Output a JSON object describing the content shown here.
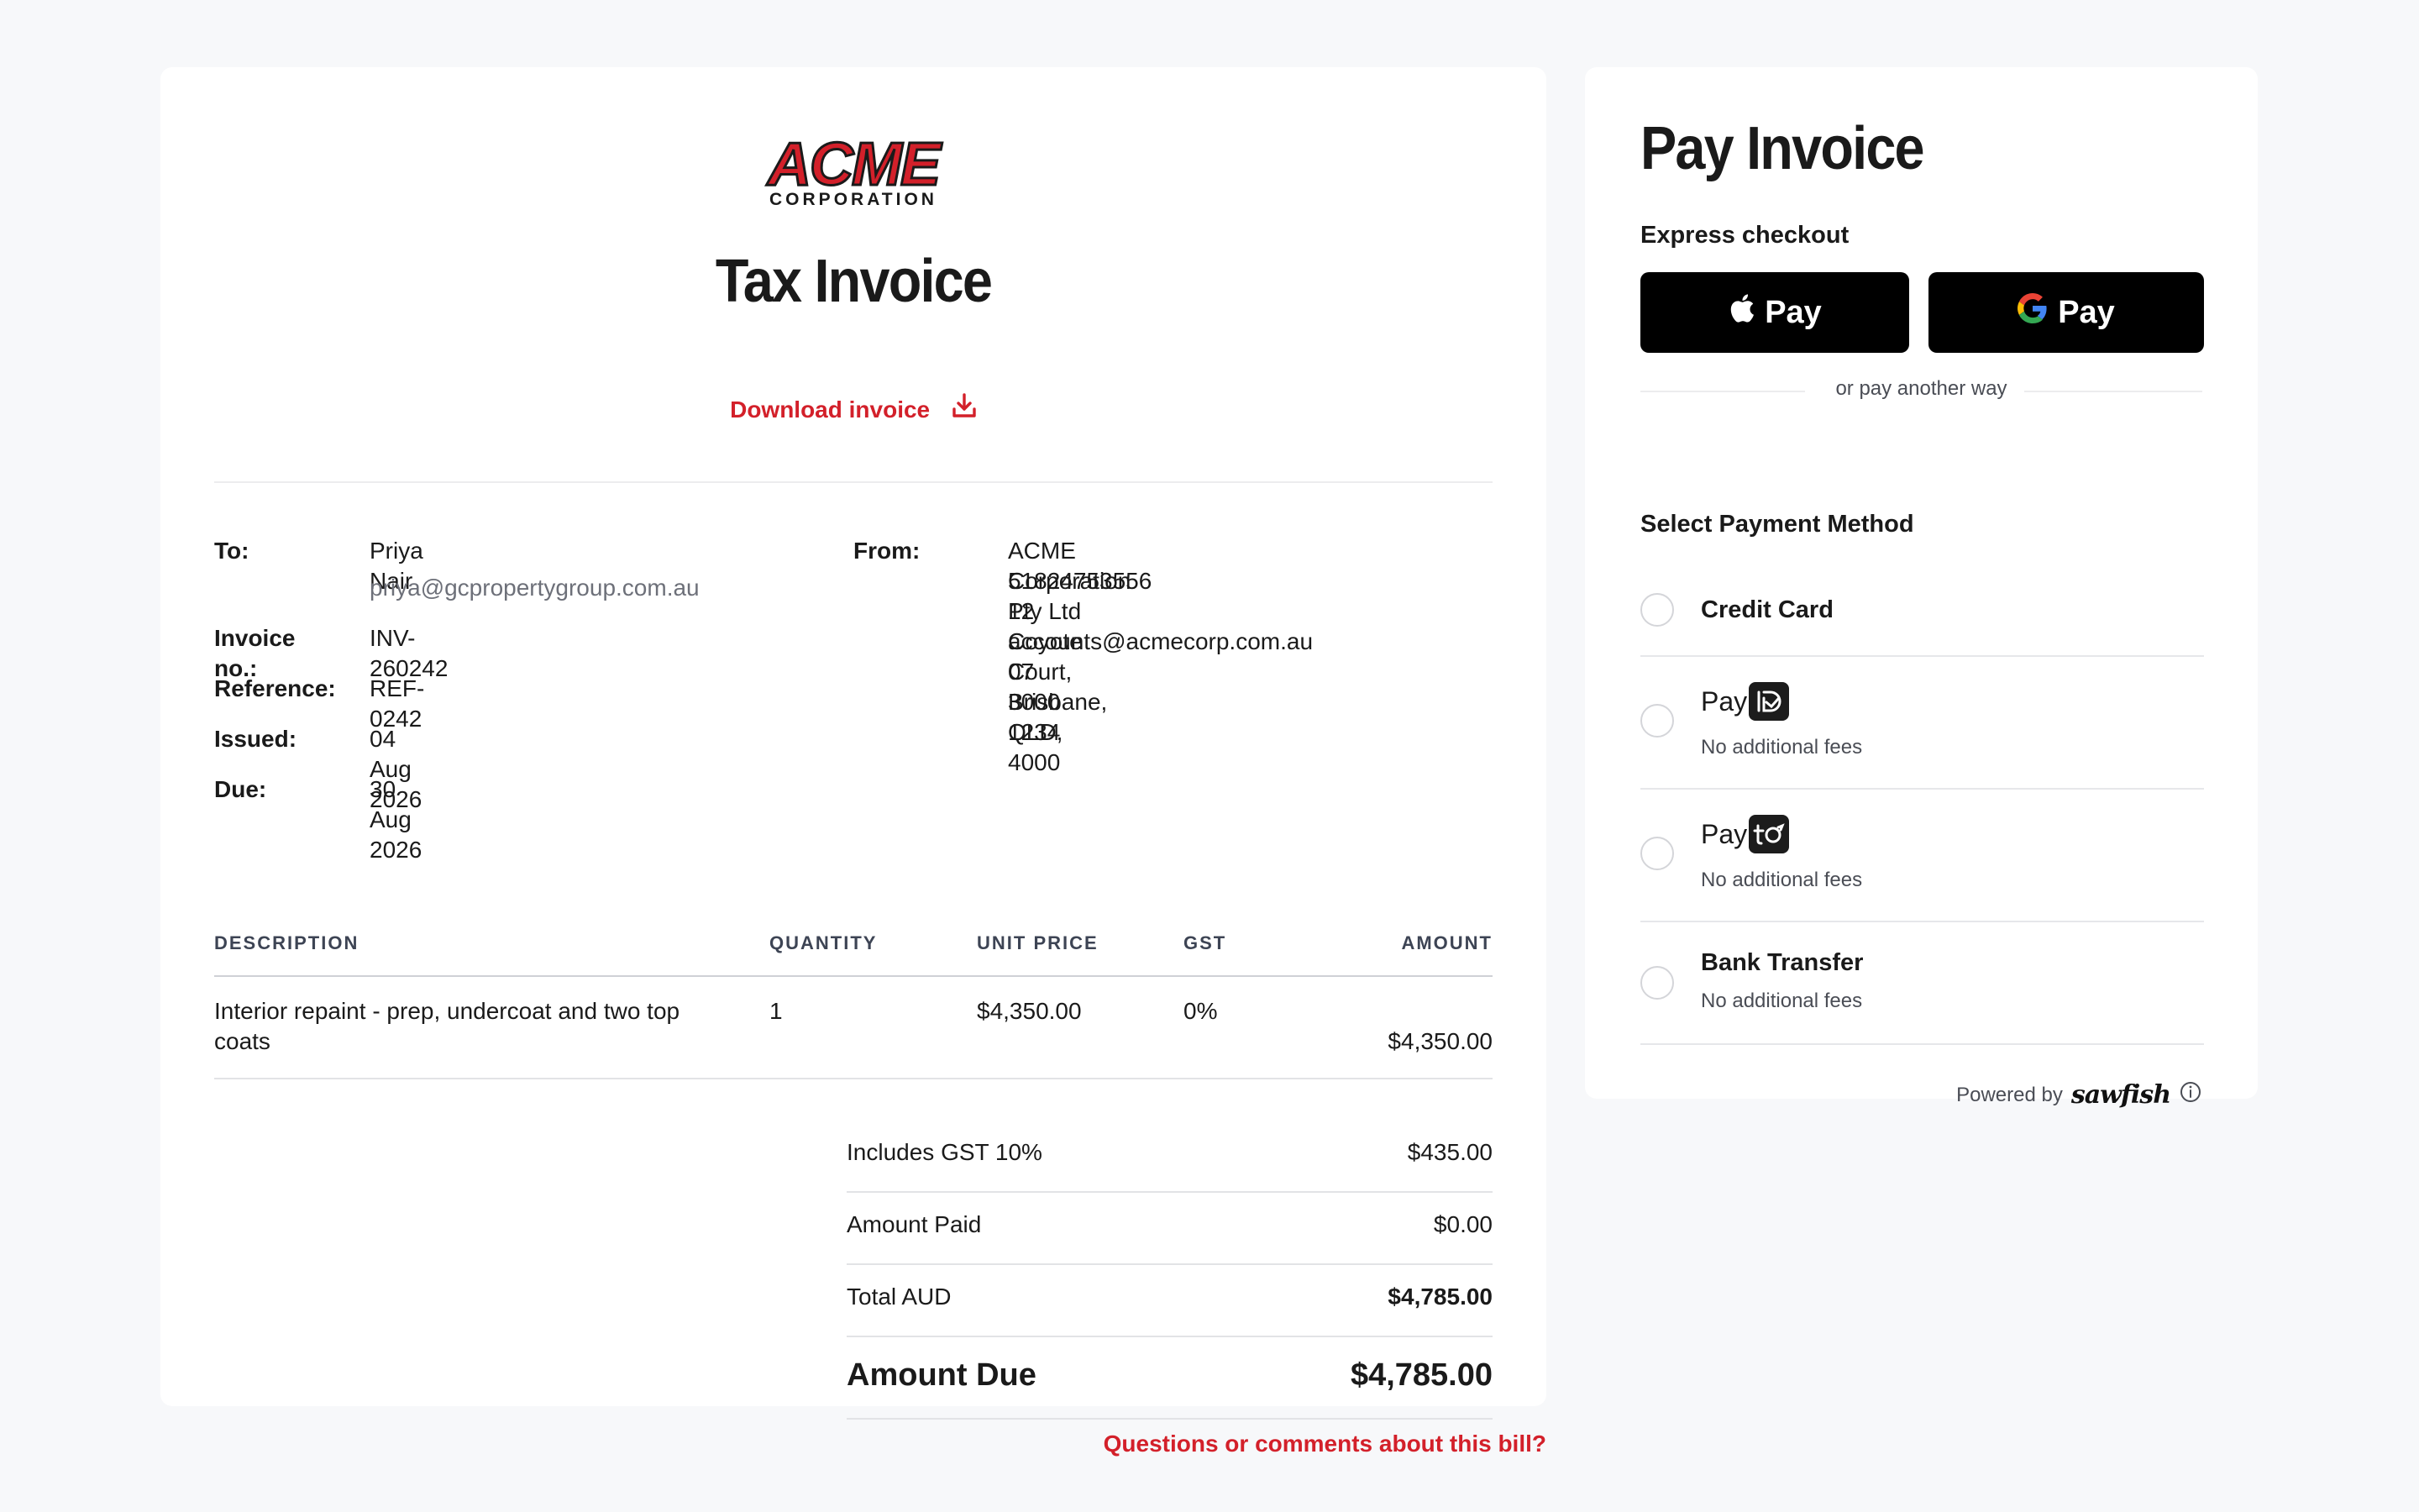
{
  "brand": {
    "logo_main": "ACME",
    "logo_sub": "CORPORATION",
    "accent_color": "#d3202a"
  },
  "invoice": {
    "title": "Tax Invoice",
    "download_label": "Download invoice",
    "to": {
      "label": "To:",
      "name": "Priya Nair",
      "email": "priya@gcpropertygroup.com.au"
    },
    "fields": [
      {
        "label": "Invoice no.:",
        "value": "INV-260242"
      },
      {
        "label": "Reference:",
        "value": "REF-0242"
      },
      {
        "label": "Issued:",
        "value": "04 Aug 2026"
      },
      {
        "label": "Due:",
        "value": "30 Aug 2026"
      }
    ],
    "from": {
      "label": "From:",
      "lines": [
        "ACME Corporation Pty Ltd",
        "51824753556",
        "12 Coyote Court, Brisbane, QLD, 4000",
        "accounts@acmecorp.com.au",
        "07 3000 1234"
      ]
    },
    "table": {
      "headers": {
        "description": "DESCRIPTION",
        "quantity": "QUANTITY",
        "unit_price": "UNIT PRICE",
        "gst": "GST",
        "amount": "AMOUNT"
      },
      "rows": [
        {
          "description_line1": "Interior repaint - prep, undercoat and two top",
          "description_line2": "coats",
          "quantity": "1",
          "unit_price": "$4,350.00",
          "gst": "0%",
          "amount": "$4,350.00"
        }
      ]
    },
    "summary": {
      "gst_label": "Includes GST 10%",
      "gst_value": "$435.00",
      "paid_label": "Amount Paid",
      "paid_value": "$0.00",
      "total_label": "Total AUD",
      "total_value": "$4,785.00",
      "due_label": "Amount Due",
      "due_value": "$4,785.00"
    },
    "questions_link": "Questions or comments about this bill?"
  },
  "payment": {
    "title": "Pay Invoice",
    "express_label": "Express checkout",
    "apple_pay_label": "Pay",
    "google_pay_label": "Pay",
    "or_text": "or pay another way",
    "select_label": "Select Payment Method",
    "methods": [
      {
        "name": "Credit Card",
        "sub": ""
      },
      {
        "name": "Pay",
        "sub": "No additional fees",
        "badge_icon": "payid-icon"
      },
      {
        "name": "Pay",
        "sub": "No additional fees",
        "badge_icon": "payto-icon"
      },
      {
        "name": "Bank Transfer",
        "sub": "No additional fees"
      }
    ],
    "powered_by": "Powered by",
    "powered_brand": "sawfish"
  }
}
